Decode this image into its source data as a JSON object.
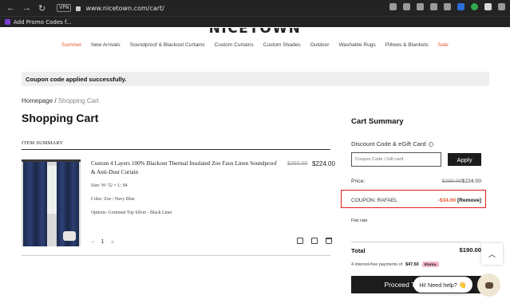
{
  "browser": {
    "url": "www.nicetown.com/cart/",
    "vpn_label": "VPN",
    "bookmark_label": "Add Promo Codes f..."
  },
  "brand": {
    "logo_text": "NICETOWN"
  },
  "nav": {
    "items": [
      {
        "label": "Summer"
      },
      {
        "label": "New Arrivals"
      },
      {
        "label": "Soundproof & Blackout Curtains"
      },
      {
        "label": "Custom Curtains"
      },
      {
        "label": "Custom Shades"
      },
      {
        "label": "Outdoor"
      },
      {
        "label": "Washable Rugs"
      },
      {
        "label": "Pillows & Blankets"
      },
      {
        "label": "Sale"
      }
    ]
  },
  "notice": {
    "text": "Coupon code applied successfully."
  },
  "breadcrumb": {
    "home": "Homepage",
    "separator": " / ",
    "current": "Shopping Cart"
  },
  "page_title": "Shopping Cart",
  "cart": {
    "summary_heading": "ITEM SUMMARY",
    "item": {
      "name": "Custom 4 Layers 100% Blackout Thermal Insulated Zoe Faux Linen Soundproof & Anti-Dust Curtain",
      "size": "Size: W: 52 × L: 84",
      "color": "Color: Zoe / Navy Blue",
      "options": "Options: Grommet Top Silver - Black Liner",
      "old_price": "$250.00",
      "price": "$224.00",
      "quantity": "1",
      "minus": "−",
      "plus": "+"
    }
  },
  "summary": {
    "title": "Cart Summary",
    "discount_label": "Discount Code & eGift Card",
    "info_glyph": "i",
    "coupon_placeholder": "Coupon Code / Gift card",
    "apply_label": "Apply",
    "price_label": "Price:",
    "price_old": "$280.00",
    "price_new": "$224.00",
    "coupon_label": "COUPON: RAFAEL",
    "coupon_amount": "-$34.00",
    "remove_label": "[Remove]",
    "shipping_label": "Flat rate",
    "total_label": "Total",
    "total_value": "$190.00",
    "installments_prefix": "4 interest-free payments of",
    "installments_amount": "$47.50",
    "klarna_label": "Klarna.",
    "checkout_label": "Proceed To Checkout"
  },
  "chat": {
    "bubble_text": "Hi! Need help?",
    "wave": "👋"
  },
  "colors": {
    "accent": "#e4572e",
    "highlight_border": "#e01b1b",
    "dark_button": "#1c1c1c"
  }
}
